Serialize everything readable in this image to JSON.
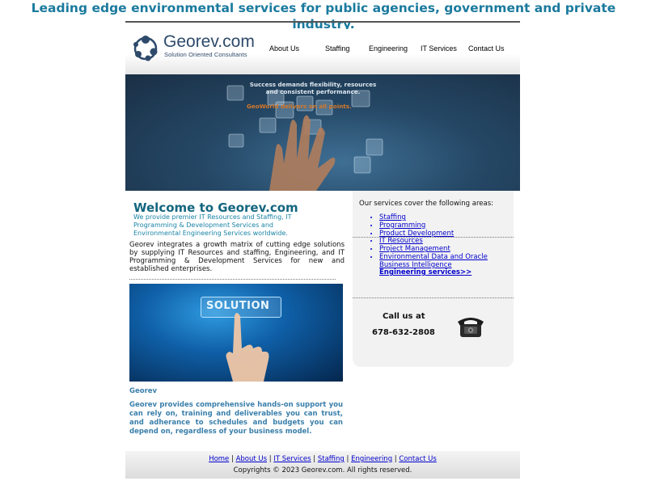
{
  "tagline": "Leading edge environmental services for public agencies, government and private industry.",
  "header": {
    "logo_name": "Georev.com",
    "logo_sub": "Solution Oriented Consultants",
    "nav": [
      "About Us",
      "Staffing",
      "Engineering",
      "IT Services",
      "Contact Us"
    ]
  },
  "hero": {
    "line1": "Success demands flexibility, resources",
    "line2": "and consistent performance.",
    "accent": "GeoWorld delivers on all points."
  },
  "welcome": {
    "title": "Welcome to Georev.com",
    "subtitle": "We provide premier IT Resources and Staffing, IT Programming & Development Services and Environmental Engineering Services worldwide.",
    "intro": "Georev integrates a growth matrix of cutting edge solutions by supplying IT Resources and staffing, Engineering, and IT Programming & Development Services for new and established enterprises."
  },
  "solution_image": {
    "text": "SOLUTION"
  },
  "georev": {
    "label": "Georev",
    "text": "Georev provides comprehensive hands-on support you can rely on, training and deliverables you can trust, and adherance to schedules and budgets you can depend on, regardless of your business model."
  },
  "services": {
    "title": "Our services cover the following areas:",
    "items": [
      "Staffing",
      "Programming",
      "Product Development",
      "IT Resources",
      "Project Management",
      "Environmental Data and Oracle Business Intelligence"
    ],
    "engineering_link": "Engineering services>>"
  },
  "contact": {
    "call_label": "Call us at",
    "phone": "678-632-2808",
    "icon": "telephone-icon"
  },
  "footer": {
    "links": [
      "Home",
      "About Us",
      "IT Services",
      "Staffing",
      "Engineering",
      "Contact Us"
    ],
    "separator": "|",
    "copyright": "Copyrights © 2023 Georev.com. All rights reserved."
  },
  "colors": {
    "tagline": "#1b7a9e",
    "logo": "#2e4a6b",
    "welcome_title": "#13667f",
    "welcome_sub": "#1b84a6",
    "georev_text": "#3a7fab",
    "link": "#0000cc",
    "hero_accent": "#d6792a"
  }
}
